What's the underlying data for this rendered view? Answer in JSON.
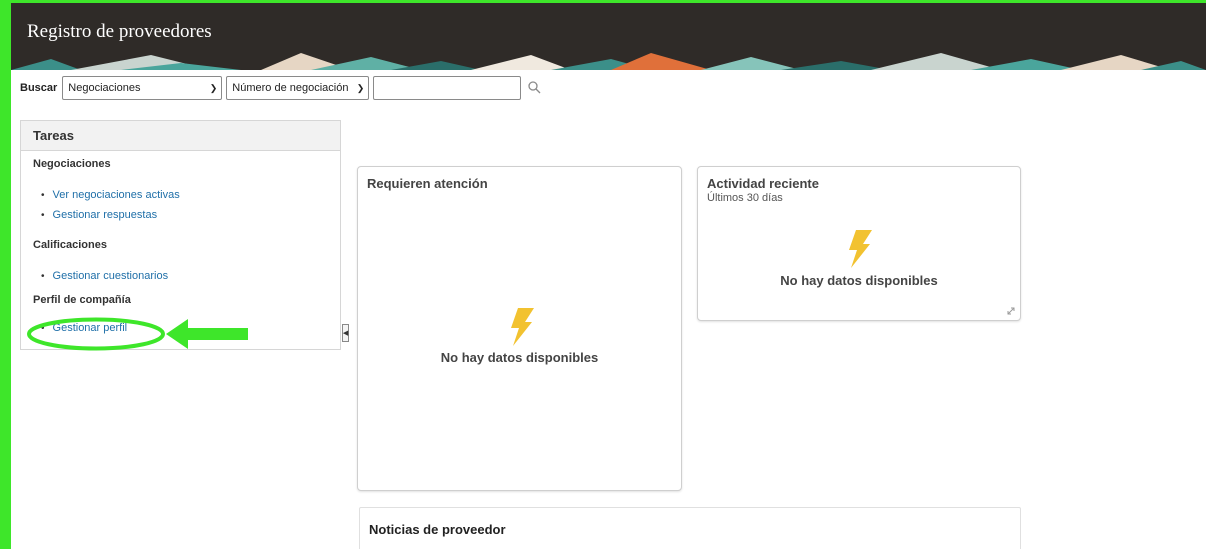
{
  "header": {
    "title": "Registro de proveedores"
  },
  "search": {
    "label": "Buscar",
    "category_select": "Negociaciones",
    "field_select": "Número de negociación",
    "query_value": ""
  },
  "tasks": {
    "title": "Tareas",
    "sections": [
      {
        "title": "Negociaciones",
        "items": [
          "Ver negociaciones activas",
          "Gestionar respuestas"
        ]
      },
      {
        "title": "Calificaciones",
        "items": [
          "Gestionar cuestionarios"
        ]
      },
      {
        "title": "Perfil de compañía",
        "items": [
          "Gestionar perfil"
        ]
      }
    ]
  },
  "cards": {
    "attention": {
      "title": "Requieren atención",
      "empty": "No hay datos disponibles"
    },
    "activity": {
      "title": "Actividad reciente",
      "subtitle": "Últimos 30 días",
      "empty": "No hay datos disponibles"
    },
    "news": {
      "title": "Noticias de proveedor"
    }
  },
  "colors": {
    "accent_annotation": "#3ee62a",
    "link": "#1f6fa8",
    "header_bg": "#2f2b28",
    "bolt": "#f2c230"
  },
  "icons": [
    "search-icon",
    "chevron-down-icon",
    "lightning-icon",
    "expand-icon",
    "collapse-icon",
    "arrow-left-icon"
  ]
}
